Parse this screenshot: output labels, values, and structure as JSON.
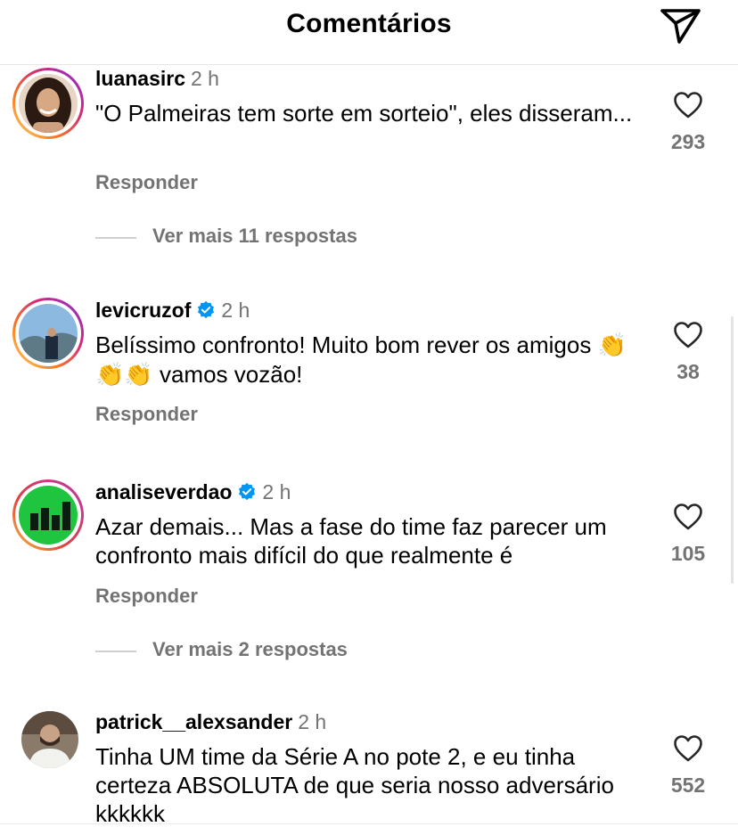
{
  "header": {
    "title": "Comentários",
    "send_icon": "paper-plane-icon"
  },
  "comments": [
    {
      "username": "luanasirc",
      "time": "2 h",
      "verified": false,
      "text": "\"O Palmeiras tem sorte em sorteio\", eles disseram...",
      "reply_label": "Responder",
      "likes": "293",
      "more_replies": "Ver mais 11 respostas"
    },
    {
      "username": "levicruzof",
      "time": "2 h",
      "verified": true,
      "text_before": "Belíssimo confronto! Muito bom rever os amigos ",
      "emoji": "👏👏👏",
      "text_after": " vamos vozão!",
      "reply_label": "Responder",
      "likes": "38"
    },
    {
      "username": "analiseverdao",
      "time": "2 h",
      "verified": true,
      "text": "Azar demais... Mas a fase do time faz parecer um confronto mais difícil do que realmente é",
      "reply_label": "Responder",
      "likes": "105",
      "more_replies": "Ver mais 2 respostas"
    },
    {
      "username": "patrick__alexsander",
      "time": "2 h",
      "verified": false,
      "text": "Tinha UM time da Série A no pote 2, e eu tinha certeza ABSOLUTA de que seria nosso adversário kkkkkk",
      "likes": "552"
    }
  ],
  "colors": {
    "verified": "#0095f6",
    "muted": "#737373",
    "story_ring": "#d62976",
    "close_friends_ring": "#1fc53e"
  }
}
